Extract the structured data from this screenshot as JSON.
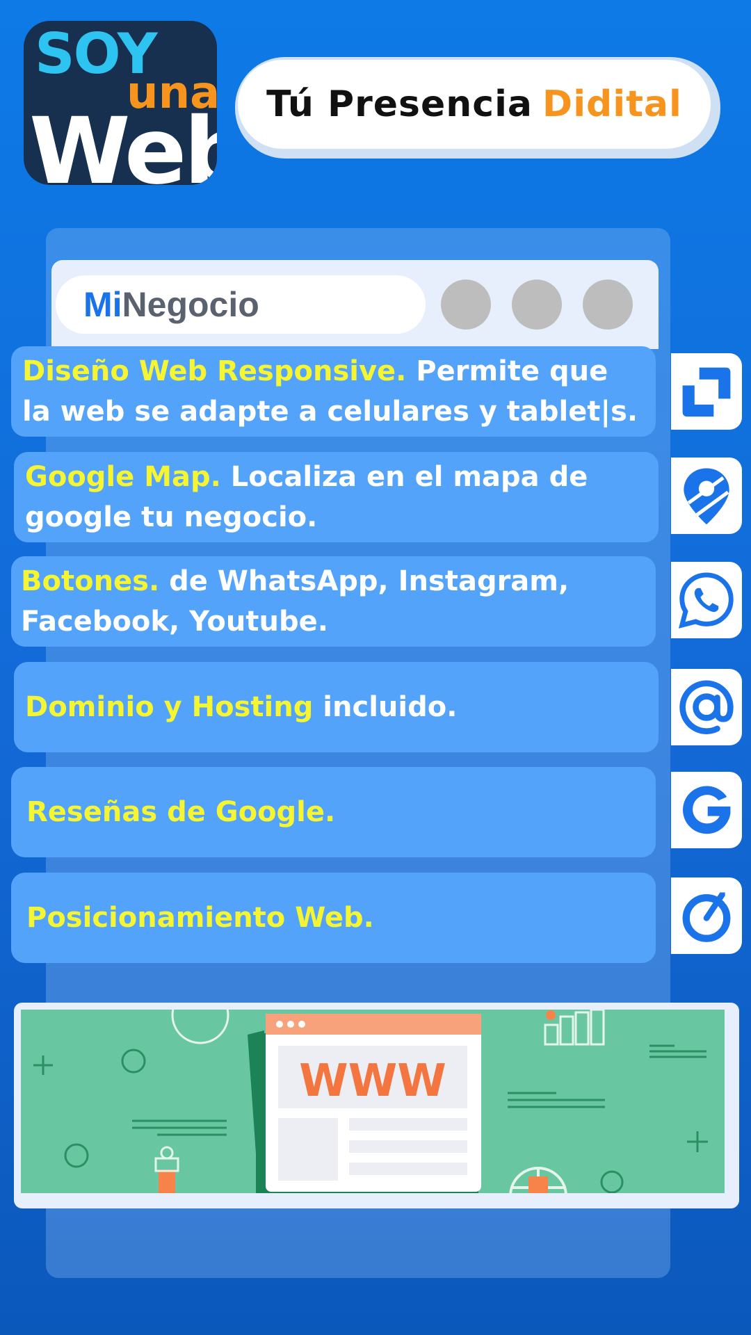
{
  "logo": {
    "line1": "SOY",
    "line2": "una",
    "line3": "Web"
  },
  "tagline": {
    "main": "Tú Presencia",
    "accent": "Didital"
  },
  "browser": {
    "url_prefix": "Mi",
    "url_suffix": "Negocio"
  },
  "features": [
    {
      "highlight": "Diseño Web Responsive.",
      "text": " Permite que la web se adapte a celulares y tablet|s.",
      "icon": "crop-icon"
    },
    {
      "highlight": "Google Map.",
      "text": " Localiza en el mapa de google tu negocio.",
      "icon": "map-pin-icon"
    },
    {
      "highlight": "Botones.",
      "text": " de WhatsApp, Instagram, Facebook, Youtube.",
      "icon": "whatsapp-icon"
    },
    {
      "highlight": "Dominio y Hosting",
      "text": " incluido.",
      "icon": "at-sign-icon"
    },
    {
      "highlight": "Reseñas de Google.",
      "text": "",
      "icon": "google-icon"
    },
    {
      "highlight": "Posicionamiento Web.",
      "text": "",
      "icon": "speed-gauge-icon"
    }
  ],
  "banner": {
    "text": "WWW"
  },
  "colors": {
    "accent_yellow": "#f5f532",
    "accent_orange": "#f7941d",
    "brand_blue": "#1a73e8",
    "feature_bg": "#53a3fb"
  }
}
